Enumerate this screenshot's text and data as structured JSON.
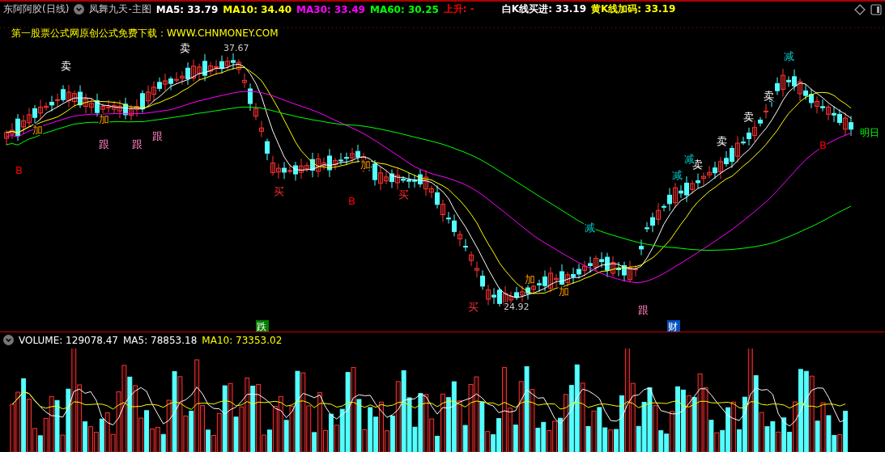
{
  "header": {
    "stock": "东阿阿胶(日线)",
    "indicator": "凤舞九天-主图",
    "indicators": [
      {
        "label": "MA5: 33.79",
        "color": "#ffffff"
      },
      {
        "label": "MA10: 34.40",
        "color": "#ffff00"
      },
      {
        "label": "MA30: 33.49",
        "color": "#ff00ff"
      },
      {
        "label": "MA60: 30.25",
        "color": "#00ff00"
      },
      {
        "label": "上升: -",
        "color": "#ff0000"
      },
      {
        "label": "白K线买进: 33.19",
        "color": "#ffffff"
      },
      {
        "label": "黄K线加码: 33.19",
        "color": "#ffff00"
      }
    ]
  },
  "chart": {
    "promo": "第一股票公式网原创公式免费下载：WWW.CHNMONEY.COM",
    "high_label": "37.67",
    "low_label": "24.92",
    "edge_label": "明日",
    "signals": [
      {
        "text": "卖",
        "kind": "sell"
      },
      {
        "text": "卖",
        "kind": "sell"
      },
      {
        "text": "卖",
        "kind": "sell"
      },
      {
        "text": "卖",
        "kind": "sell"
      },
      {
        "text": "卖",
        "kind": "sell"
      },
      {
        "text": "卖",
        "kind": "sell"
      },
      {
        "text": "加",
        "kind": "add"
      },
      {
        "text": "加",
        "kind": "add"
      },
      {
        "text": "加",
        "kind": "add"
      },
      {
        "text": "加",
        "kind": "add"
      },
      {
        "text": "加",
        "kind": "add"
      },
      {
        "text": "跟",
        "kind": "follow"
      },
      {
        "text": "跟",
        "kind": "follow"
      },
      {
        "text": "跟",
        "kind": "follow"
      },
      {
        "text": "跟",
        "kind": "follow"
      },
      {
        "text": "B",
        "kind": "buy"
      },
      {
        "text": "B",
        "kind": "buy"
      },
      {
        "text": "B",
        "kind": "buy"
      },
      {
        "text": "减",
        "kind": "reduce"
      },
      {
        "text": "减",
        "kind": "reduce"
      },
      {
        "text": "减",
        "kind": "reduce"
      },
      {
        "text": "减",
        "kind": "reduce"
      },
      {
        "text": "买",
        "kind": "entry"
      },
      {
        "text": "买",
        "kind": "entry"
      },
      {
        "text": "买",
        "kind": "entry"
      }
    ],
    "badges": [
      {
        "text": "跌",
        "color": "#008000"
      },
      {
        "text": "财",
        "color": "#0050c0"
      }
    ]
  },
  "volume": {
    "title": "VOLUME: 129078.47",
    "ma5": "MA5: 78853.18",
    "ma10": "MA10: 73353.02"
  }
}
